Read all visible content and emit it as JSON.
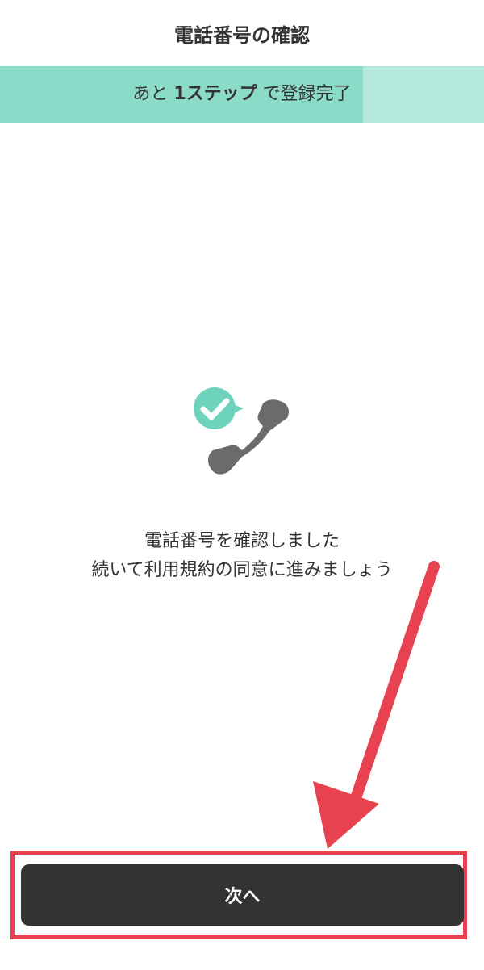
{
  "header": {
    "title": "電話番号の確認"
  },
  "progress": {
    "prefix": "あと",
    "step_label": "1ステップ",
    "suffix": "で登録完了",
    "fraction": 0.75
  },
  "illustration": {
    "icon": "phone-verified-icon",
    "check_color": "#6dd3bd",
    "phone_color": "#6b6b6b"
  },
  "message": {
    "line1": "電話番号を確認しました",
    "line2": "続いて利用規約の同意に進みましょう"
  },
  "actions": {
    "next_label": "次へ"
  },
  "annotation": {
    "color": "#e8414f"
  }
}
